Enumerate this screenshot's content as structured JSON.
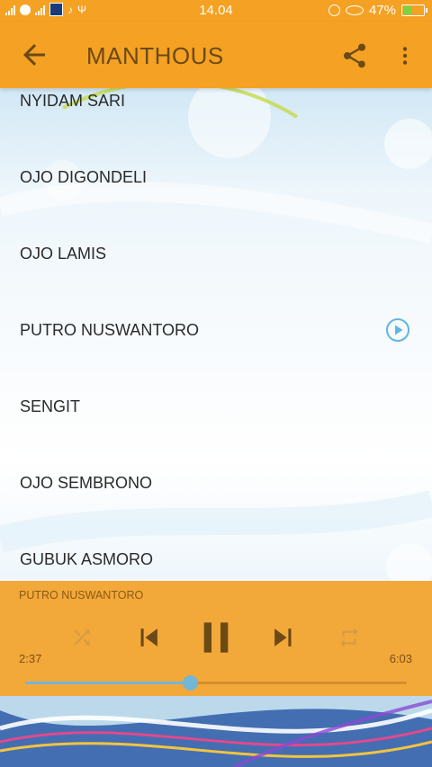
{
  "status_bar": {
    "time": "14.04",
    "battery_percent": "47%",
    "battery_level": 0.47
  },
  "app_bar": {
    "title": "MANTHOUS"
  },
  "songs": [
    {
      "label": "NYIDAM SARI"
    },
    {
      "label": "OJO DIGONDELI"
    },
    {
      "label": "OJO LAMIS"
    },
    {
      "label": "PUTRO NUSWANTORO",
      "playing": true
    },
    {
      "label": "SENGIT"
    },
    {
      "label": "OJO SEMBRONO"
    },
    {
      "label": "GUBUK ASMORO"
    }
  ],
  "player": {
    "now_playing": "PUTRO NUSWANTORO",
    "elapsed": "2:37",
    "total": "6:03",
    "progress": 0.432
  },
  "colors": {
    "accent": "#f5a123",
    "player_bg": "#f3a83a",
    "seek_played": "#74b6d6",
    "title_text": "#6b4a16"
  }
}
